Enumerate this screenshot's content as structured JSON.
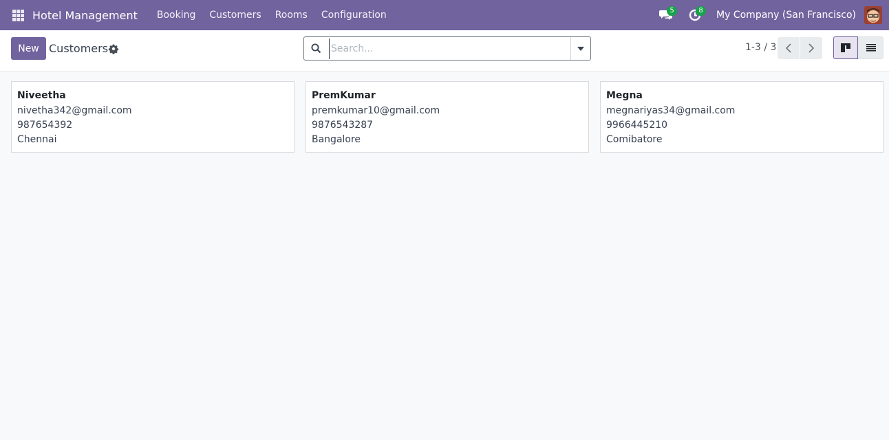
{
  "navbar": {
    "app_name": "Hotel Management",
    "menu": [
      "Booking",
      "Customers",
      "Rooms",
      "Configuration"
    ],
    "messages_count": "5",
    "activities_count": "8",
    "company": "My Company (San Francisco)"
  },
  "control_panel": {
    "new_label": "New",
    "title": "Customers",
    "search_placeholder": "Search...",
    "pager": "1-3 / 3"
  },
  "customers": [
    {
      "name": "Niveetha",
      "email": "nivetha342@gmail.com",
      "phone": "987654392",
      "city": "Chennai"
    },
    {
      "name": "PremKumar",
      "email": "premkumar10@gmail.com",
      "phone": "9876543287",
      "city": "Bangalore"
    },
    {
      "name": "Megna",
      "email": "megnariyas34@gmail.com",
      "phone": "9966445210",
      "city": "Comibatore"
    }
  ],
  "colors": {
    "brand": "#71639e",
    "badge": "#17a34a",
    "background": "#f8f9fa"
  },
  "icons": {
    "apps": "apps-grid-icon",
    "messages": "chat-bubbles-icon",
    "activities": "clock-icon",
    "settings": "gear-icon",
    "search": "search-icon",
    "toggle": "caret-down-icon",
    "prev": "chevron-left-icon",
    "next": "chevron-right-icon",
    "kanban": "kanban-view-icon",
    "list": "list-view-icon"
  }
}
